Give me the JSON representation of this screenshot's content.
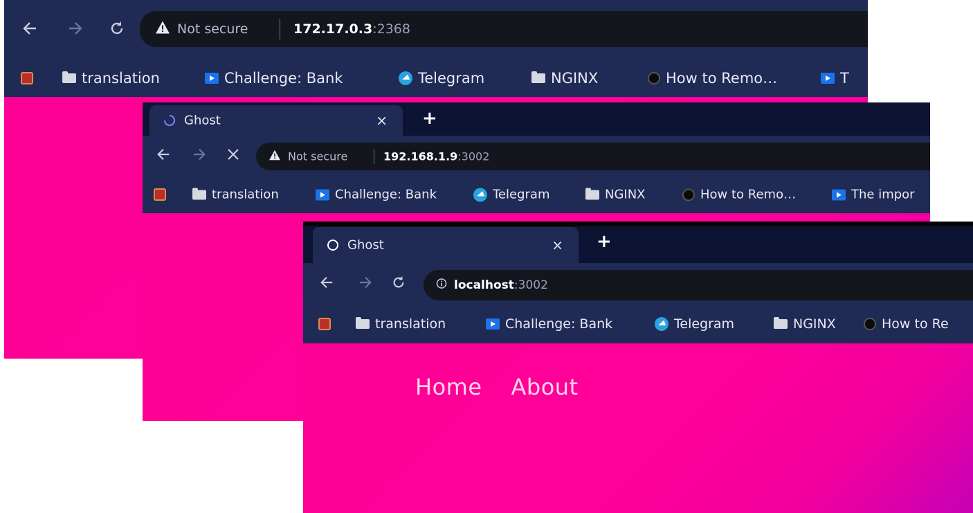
{
  "bookmarks": [
    {
      "label": "",
      "icon": "app-icon"
    },
    {
      "label": "translation",
      "icon": "folder-icon"
    },
    {
      "label": "Challenge: Bank",
      "icon": "video-icon"
    },
    {
      "label": "Telegram",
      "icon": "telegram-icon"
    },
    {
      "label": "NGINX",
      "icon": "folder-icon"
    },
    {
      "label": "How to Remo…",
      "icon": "hexagon-icon"
    }
  ],
  "window1": {
    "security_label": "Not secure",
    "url_host": "172.17.0.3",
    "url_port": ":2368",
    "bookmark_truncated": "T"
  },
  "window2": {
    "tab_title": "Ghost",
    "tab_close": "×",
    "new_tab": "+",
    "security_label": "Not secure",
    "url_host": "192.168.1.9",
    "url_port": ":3002",
    "bookmark_extra": "The impor"
  },
  "window3": {
    "tab_title": "Ghost",
    "tab_close": "×",
    "new_tab": "+",
    "url_host": "localhost",
    "url_port": ":3002",
    "bookmark_truncated": "How to Re",
    "site_nav": [
      "Home",
      "About"
    ]
  }
}
